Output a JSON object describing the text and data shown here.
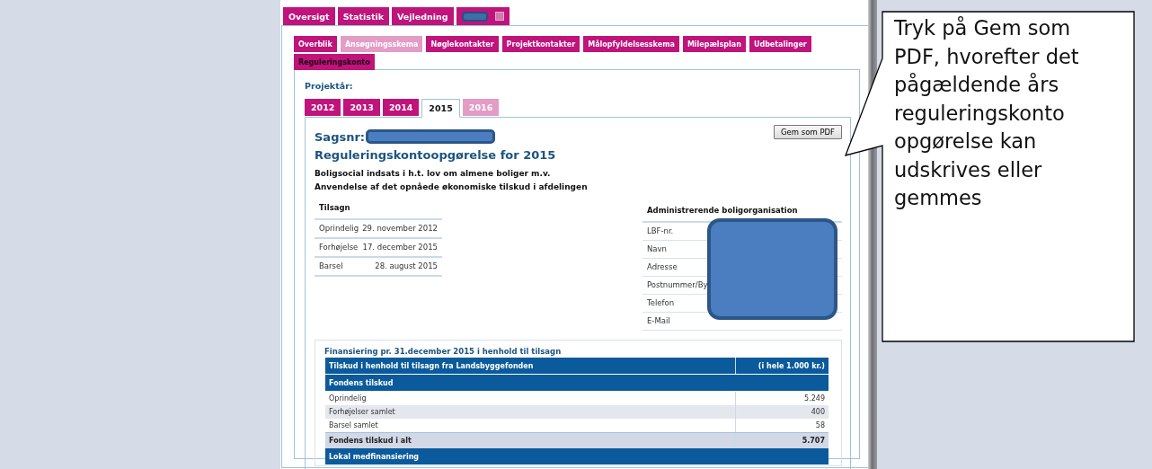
{
  "top_tabs": [
    {
      "label": "Oversigt"
    },
    {
      "label": "Statistik"
    },
    {
      "label": "Vejledning"
    },
    {
      "kind": "redacted"
    }
  ],
  "sub_tabs": [
    {
      "label": "Overblik",
      "selected": false,
      "disabled": false
    },
    {
      "label": "Ansøgningsskema",
      "selected": false,
      "disabled": true
    },
    {
      "label": "Nøglekontakter",
      "selected": false,
      "disabled": false
    },
    {
      "label": "Projektkontakter",
      "selected": false,
      "disabled": false
    },
    {
      "label": "Målopfyldelsesskema",
      "selected": false,
      "disabled": false
    },
    {
      "label": "Milepælsplan",
      "selected": false,
      "disabled": false
    },
    {
      "label": "Udbetalinger",
      "selected": false,
      "disabled": false
    },
    {
      "label": "Reguleringskonto",
      "selected": true,
      "disabled": false
    }
  ],
  "year_label": "Projektår:",
  "year_tabs": [
    {
      "label": "2012",
      "selected": false,
      "disabled": false
    },
    {
      "label": "2013",
      "selected": false,
      "disabled": false
    },
    {
      "label": "2014",
      "selected": false,
      "disabled": false
    },
    {
      "label": "2015",
      "selected": true,
      "disabled": false
    },
    {
      "label": "2016",
      "selected": false,
      "disabled": true
    }
  ],
  "pdf_button": "Gem som PDF",
  "case_label": "Sagsnr:",
  "title": "Reguleringskontoopgørelse for 2015",
  "subtitles": [
    "Boligsocial indsats i h.t. lov om almene boliger m.v.",
    "Anvendelse af det opnåede økonomiske tilskud i afdelingen"
  ],
  "grant_table": {
    "heading": "Tilsagn",
    "rows": [
      {
        "label": "Oprindelig",
        "value": "29. november 2012"
      },
      {
        "label": "Forhøjelse",
        "value": "17. december 2015"
      },
      {
        "label": "Barsel",
        "value": "28. august 2015"
      }
    ]
  },
  "org_table": {
    "heading": "Administrerende boligorganisation",
    "rows": [
      "LBF-nr.",
      "Navn",
      "Adresse",
      "Postnummer/By",
      "Telefon",
      "E-Mail"
    ]
  },
  "financing": {
    "legend": "Finansiering pr. 31.december 2015 i henhold til tilsagn",
    "rows": [
      {
        "kind": "header",
        "label": "Tilskud i henhold til tilsagn fra Landsbyggefonden",
        "value": "(i hele 1.000 kr.)"
      },
      {
        "kind": "section",
        "label": "Fondens tilskud"
      },
      {
        "kind": "row",
        "label": "Oprindelig",
        "value": "5.249"
      },
      {
        "kind": "row",
        "label": "Forhøjelser samlet",
        "value": "400"
      },
      {
        "kind": "row",
        "label": "Barsel samlet",
        "value": "58"
      },
      {
        "kind": "total",
        "label": "Fondens tilskud i alt",
        "value": "5.707"
      },
      {
        "kind": "section",
        "label": "Lokal medfinansiering"
      }
    ]
  },
  "callout": "Tryk på Gem som PDF, hvorefter det pågældende års reguleringskonto opgørelse kan udskrives eller gemmes"
}
